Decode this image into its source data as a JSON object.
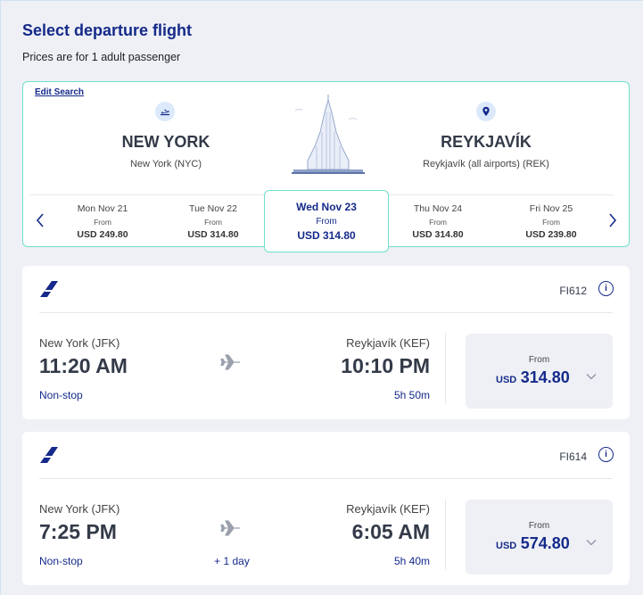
{
  "header": {
    "title": "Select departure flight",
    "subtitle": "Prices are for 1 adult passenger"
  },
  "search": {
    "edit_label": "Edit Search",
    "origin": {
      "city": "NEW YORK",
      "detail": "New York (NYC)",
      "icon": "plane-departure-icon"
    },
    "destination": {
      "city": "REYKJAVÍK",
      "detail": "Reykjavík (all airports) (REK)",
      "icon": "location-pin-icon"
    },
    "dates": [
      {
        "day": "Mon Nov 21",
        "from": "From",
        "price": "USD 249.80",
        "selected": false
      },
      {
        "day": "Tue Nov 22",
        "from": "From",
        "price": "USD 314.80",
        "selected": false
      },
      {
        "day": "Wed Nov 23",
        "from": "From",
        "price": "USD 314.80",
        "selected": true
      },
      {
        "day": "Thu Nov 24",
        "from": "From",
        "price": "USD 314.80",
        "selected": false
      },
      {
        "day": "Fri Nov 25",
        "from": "From",
        "price": "USD 239.80",
        "selected": false
      }
    ]
  },
  "flights": [
    {
      "number": "FI612",
      "from_airport": "New York (JFK)",
      "dep_time": "11:20 AM",
      "stops": "Non-stop",
      "to_airport": "Reykjavík (KEF)",
      "arr_time": "10:10 PM",
      "duration": "5h 50m",
      "day_offset": "",
      "price_from": "From",
      "currency": "USD",
      "price": "314.80"
    },
    {
      "number": "FI614",
      "from_airport": "New York (JFK)",
      "dep_time": "7:25 PM",
      "stops": "Non-stop",
      "to_airport": "Reykjavík (KEF)",
      "arr_time": "6:05 AM",
      "duration": "5h 40m",
      "day_offset": "+ 1 day",
      "price_from": "From",
      "currency": "USD",
      "price": "574.80"
    }
  ],
  "colors": {
    "brand": "#152a8a",
    "accent": "#6ee0c9",
    "background": "#eef0f5"
  }
}
